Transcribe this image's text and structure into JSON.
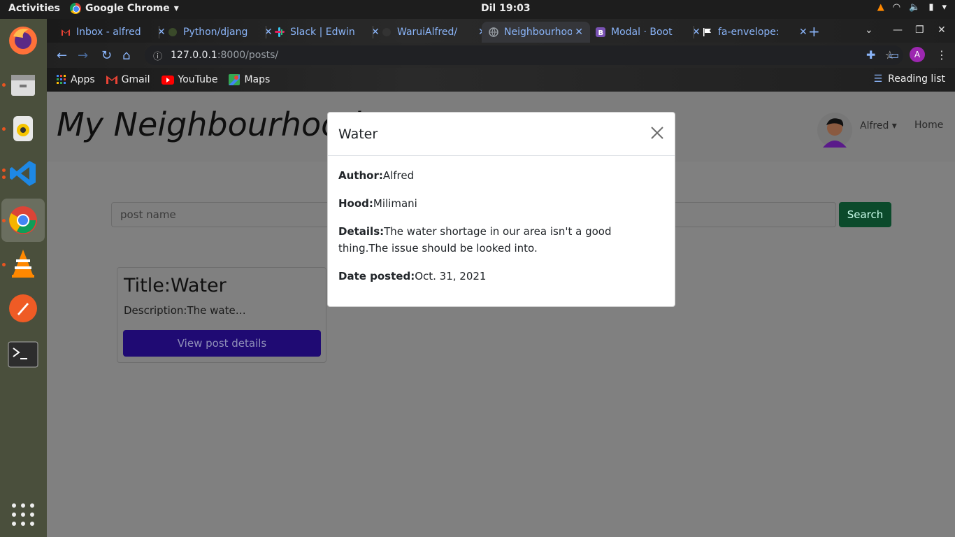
{
  "os": {
    "activities_label": "Activities",
    "app_menu_label": "Google Chrome",
    "clock": "Dil 19:03"
  },
  "browser": {
    "tabs": [
      {
        "title": "Inbox - alfred",
        "favicon": "gmail-icon",
        "active": false
      },
      {
        "title": "Python/djang",
        "favicon": "python-icon",
        "active": false
      },
      {
        "title": "Slack | Edwin",
        "favicon": "slack-icon",
        "active": false
      },
      {
        "title": "WaruiAlfred/",
        "favicon": "github-icon",
        "active": false
      },
      {
        "title": "Neighbourhoo",
        "favicon": "globe-icon",
        "active": true
      },
      {
        "title": "Modal · Boot",
        "favicon": "bootstrap-icon",
        "active": false
      },
      {
        "title": "fa-envelope:",
        "favicon": "flag-icon",
        "active": false
      }
    ],
    "url_host": "127.0.0.1",
    "url_path": ":8000/posts/",
    "profile_initial": "A",
    "bookmarks": {
      "apps": "Apps",
      "gmail": "Gmail",
      "youtube": "YouTube",
      "maps": "Maps"
    },
    "reading_list": "Reading list"
  },
  "site": {
    "brand": "My Neighbourhood",
    "user_name": "Alfred",
    "home_link": "Home",
    "search_placeholder": "post name",
    "search_button": "Search"
  },
  "post_card": {
    "title": "Title:Water",
    "description": "Description:The wate…",
    "button_label": "View post details"
  },
  "modal": {
    "title": "Water",
    "author_label": "Author:",
    "author": "Alfred",
    "hood_label": "Hood:",
    "hood": "Milimani",
    "details_label": "Details:",
    "details": "The water shortage in our area isn't a good thing.The issue should be looked into.",
    "date_label": "Date posted:",
    "date": "Oct. 31, 2021"
  },
  "colors": {
    "search_button": "#0b4a2b",
    "card_button": "#1f0a73",
    "overlay": "#808080",
    "ubuntu_accent": "#e95420"
  }
}
